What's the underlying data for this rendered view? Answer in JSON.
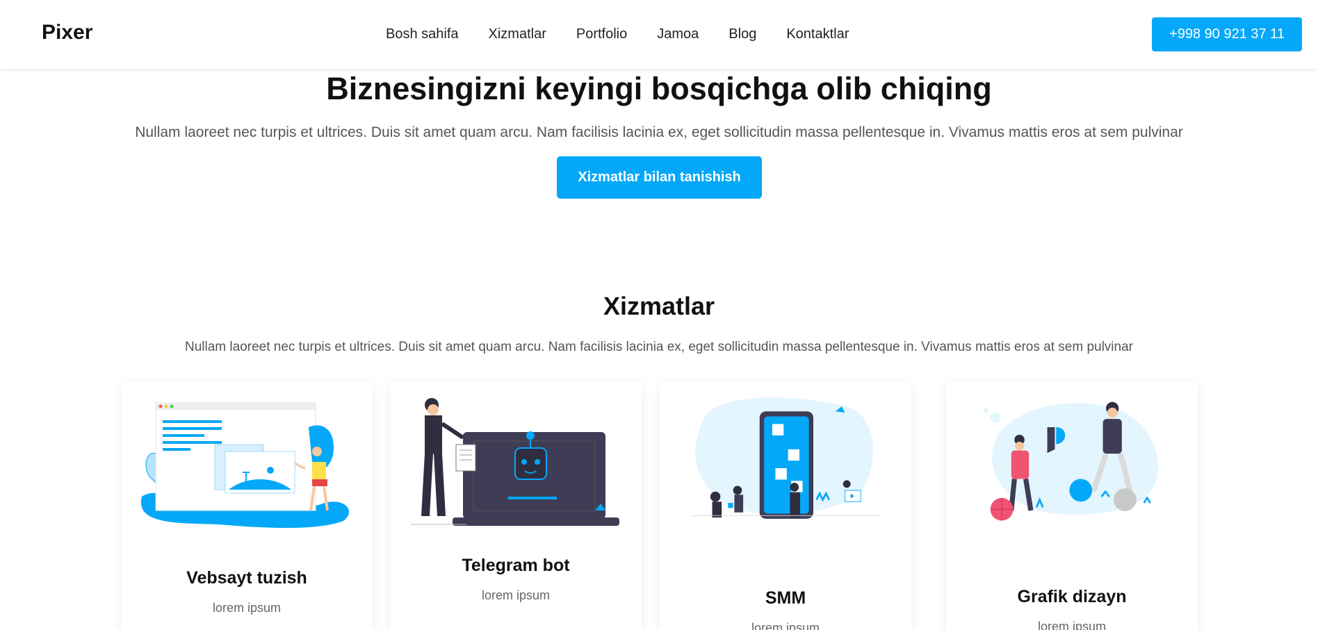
{
  "header": {
    "logo": "Pixer",
    "nav": [
      "Bosh sahifa",
      "Xizmatlar",
      "Portfolio",
      "Jamoa",
      "Blog",
      "Kontaktlar"
    ],
    "phone": "+998 90 921 37 11"
  },
  "hero": {
    "title": "Biznesingizni keyingi bosqichga olib chiqing",
    "text": "Nullam laoreet nec turpis et ultrices. Duis sit amet quam arcu. Nam facilisis lacinia ex, eget sollicitudin massa pellentesque in. Vivamus mattis eros at sem pulvinar",
    "button": "Xizmatlar bilan tanishish"
  },
  "services": {
    "title": "Xizmatlar",
    "text": "Nullam laoreet nec turpis et ultrices. Duis sit amet quam arcu. Nam facilisis lacinia ex, eget sollicitudin massa pellentesque in. Vivamus mattis eros at sem pulvinar",
    "cards": [
      {
        "title": "Vebsayt tuzish",
        "sub": "lorem ipsum",
        "icon": "website-illustration"
      },
      {
        "title": "Telegram bot",
        "sub": "lorem ipsum",
        "icon": "bot-illustration"
      },
      {
        "title": "SMM",
        "sub": "lorem ipsum",
        "icon": "smm-illustration"
      },
      {
        "title": "Grafik dizayn",
        "sub": "lorem ipsum",
        "icon": "design-illustration"
      }
    ]
  },
  "colors": {
    "accent": "#05a8f8"
  }
}
